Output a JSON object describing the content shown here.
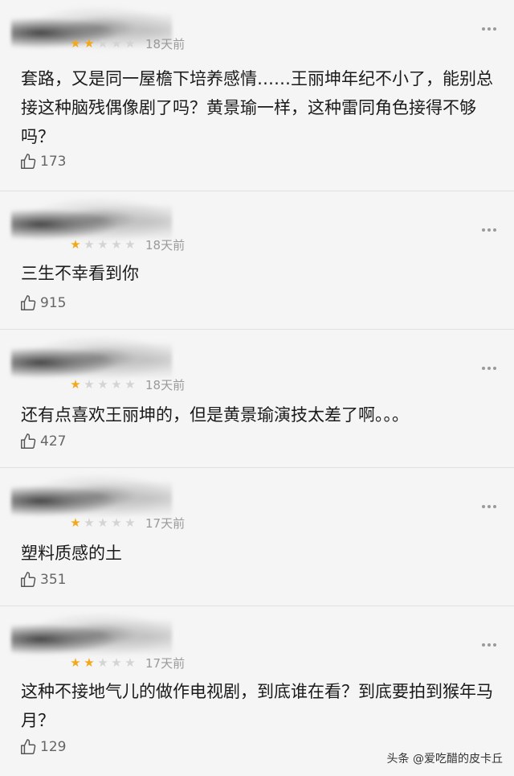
{
  "comments": [
    {
      "stars": 2,
      "time": "18天前",
      "text": "套路，又是同一屋檐下培养感情……王丽坤年纪不小了，能别总接这种脑残偶像剧了吗？黄景瑜一样，这种雷同角色接得不够吗？",
      "likes": "173"
    },
    {
      "stars": 1,
      "time": "18天前",
      "text": "三生不幸看到你",
      "likes": "915"
    },
    {
      "stars": 1,
      "time": "18天前",
      "text": "还有点喜欢王丽坤的，但是黄景瑜演技太差了啊。。。",
      "likes": "427"
    },
    {
      "stars": 1,
      "time": "17天前",
      "text": "塑料质感的土",
      "likes": "351"
    },
    {
      "stars": 2,
      "time": "17天前",
      "text": "这种不接地气儿的做作电视剧，到底谁在看？到底要拍到猴年马月？",
      "likes": "129"
    }
  ],
  "watermark": "头条 @爱吃醋的皮卡丘",
  "colors": {
    "star_on": "#f3a81b",
    "star_off": "#d4d4d4",
    "background": "#f5f5f5"
  }
}
